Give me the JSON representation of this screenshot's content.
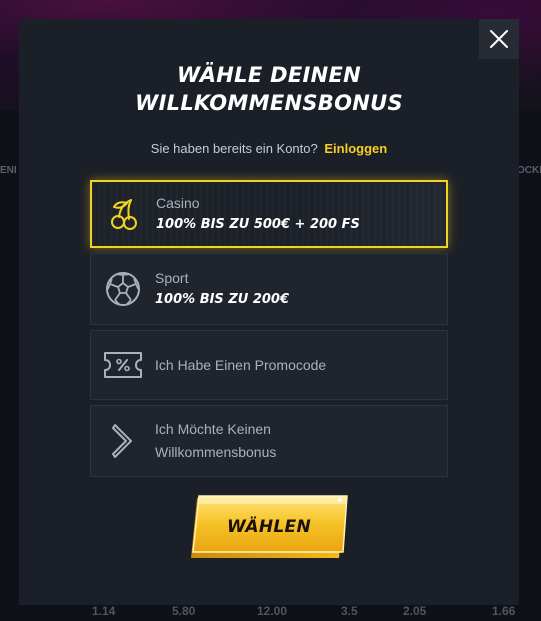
{
  "background": {
    "banner_text": "",
    "side_labels": [
      "ENI",
      "OCKE"
    ],
    "odds": [
      "1.14",
      "5.80",
      "12.00",
      "3.5",
      "2.05",
      "1.66"
    ]
  },
  "modal": {
    "title_line1": "WÄHLE DEINEN",
    "title_line2": "WILLKOMMENSBONUS",
    "login_prompt": "Sie haben bereits ein Konto?",
    "login_link": "Einloggen",
    "options": [
      {
        "label": "Casino",
        "sub": "100% BIS ZU 500€ + 200 FS",
        "icon": "cherries-icon",
        "selected": true
      },
      {
        "label": "Sport",
        "sub": "100% BIS ZU 200€",
        "icon": "soccer-ball-icon",
        "selected": false
      },
      {
        "label": "Ich Habe Einen Promocode",
        "icon": "percent-ticket-icon",
        "selected": false
      },
      {
        "label_line1": "Ich Möchte Keinen",
        "label_line2": "Willkommensbonus",
        "icon": "chevron-right-icon",
        "selected": false
      }
    ],
    "submit_label": "WÄHLEN"
  },
  "colors": {
    "accent_yellow": "#f2d41e",
    "modal_bg": "#1b1f27",
    "option_bg": "#20242c"
  }
}
